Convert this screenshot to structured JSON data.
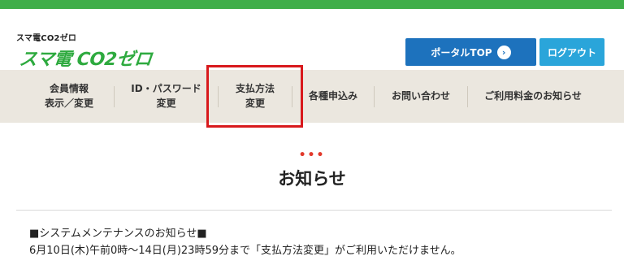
{
  "header": {
    "brand_sub": "スマ電CO2ゼロ",
    "logo_text": "スマ電 CO2ゼロ",
    "portal_button": "ポータルTOP",
    "logout_button": "ログアウト"
  },
  "nav": {
    "items": [
      {
        "label": "会員情報\n表示／変更"
      },
      {
        "label": "ID・パスワード\n変更"
      },
      {
        "label": "支払方法\n変更"
      },
      {
        "label": "各種申込み"
      },
      {
        "label": "お問い合わせ"
      },
      {
        "label": "ご利用料金のお知らせ"
      }
    ]
  },
  "main": {
    "dots": "•••",
    "title": "お知らせ",
    "notice_heading": "■システムメンテナンスのお知らせ■",
    "notice_body": "6月10日(木)午前0時～14日(月)23時59分まで「支払方法変更」がご利用いただけません。"
  },
  "colors": {
    "brand_green": "#3fae49",
    "portal_blue": "#1d72bd",
    "logout_blue": "#2aa5da",
    "nav_bg": "#ebe7df",
    "highlight_red": "#d8191c"
  },
  "icons": {
    "portal_arrow": "chevron-right-circle-icon"
  }
}
